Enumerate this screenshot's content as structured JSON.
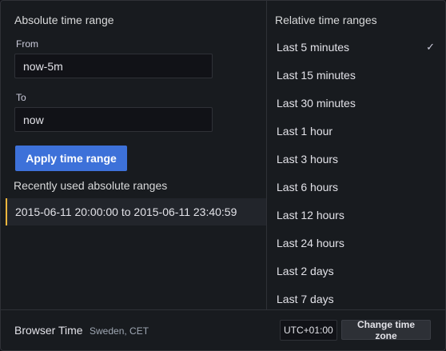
{
  "absolute": {
    "title": "Absolute time range",
    "from_label": "From",
    "from_value": "now-5m",
    "to_label": "To",
    "to_value": "now",
    "apply_label": "Apply time range"
  },
  "recent": {
    "title": "Recently used absolute ranges",
    "items": [
      "2015-06-11 20:00:00 to 2015-06-11 23:40:59"
    ]
  },
  "relative": {
    "title": "Relative time ranges",
    "selected_index": 0,
    "items": [
      "Last 5 minutes",
      "Last 15 minutes",
      "Last 30 minutes",
      "Last 1 hour",
      "Last 3 hours",
      "Last 6 hours",
      "Last 12 hours",
      "Last 24 hours",
      "Last 2 days",
      "Last 7 days"
    ]
  },
  "footer": {
    "timezone_label": "Browser Time",
    "timezone_detail": "Sweden, CET",
    "utc_offset": "UTC+01:00",
    "change_tz_label": "Change time zone"
  },
  "icons": {
    "selected": "checkmark-icon"
  },
  "colors": {
    "primary": "#3d71d9",
    "recent_accent": "#f5b73d",
    "background": "#181b1f"
  }
}
